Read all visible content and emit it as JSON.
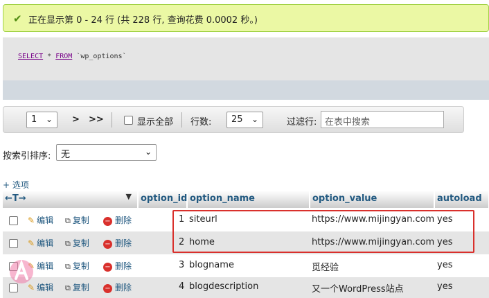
{
  "success_message": "正在显示第 0 - 24 行 (共 228 行, 查询花费 0.0002 秒。)",
  "sql": {
    "kw_select": "SELECT",
    "star": "*",
    "kw_from": "FROM",
    "table": "`wp_options`"
  },
  "nav": {
    "page_value": "1",
    "next": ">",
    "last": ">>",
    "show_all_label": "显示全部",
    "rows_label": "行数:",
    "rows_value": "25",
    "filter_label": "过滤行:",
    "filter_placeholder": "在表中搜索"
  },
  "sort": {
    "label": "按索引排序:",
    "value": "无"
  },
  "options_label": "+ 选项",
  "table": {
    "headers": {
      "id": "option_id",
      "name": "option_name",
      "value": "option_value",
      "autoload": "autoload"
    },
    "actions": {
      "edit": "编辑",
      "copy": "复制",
      "delete": "删除"
    },
    "rows": [
      {
        "id": "1",
        "name": "siteurl",
        "value": "https://www.mijingyan.com",
        "autoload": "yes"
      },
      {
        "id": "2",
        "name": "home",
        "value": "https://www.mijingyan.com",
        "autoload": "yes"
      },
      {
        "id": "3",
        "name": "blogname",
        "value": "觅经验",
        "autoload": "yes"
      },
      {
        "id": "4",
        "name": "blogdescription",
        "value": "又一个WordPress站点",
        "autoload": "yes"
      }
    ]
  },
  "colors": {
    "success_bg": "#ebf8a4",
    "link": "#235a81",
    "highlight": "#d9302c"
  }
}
